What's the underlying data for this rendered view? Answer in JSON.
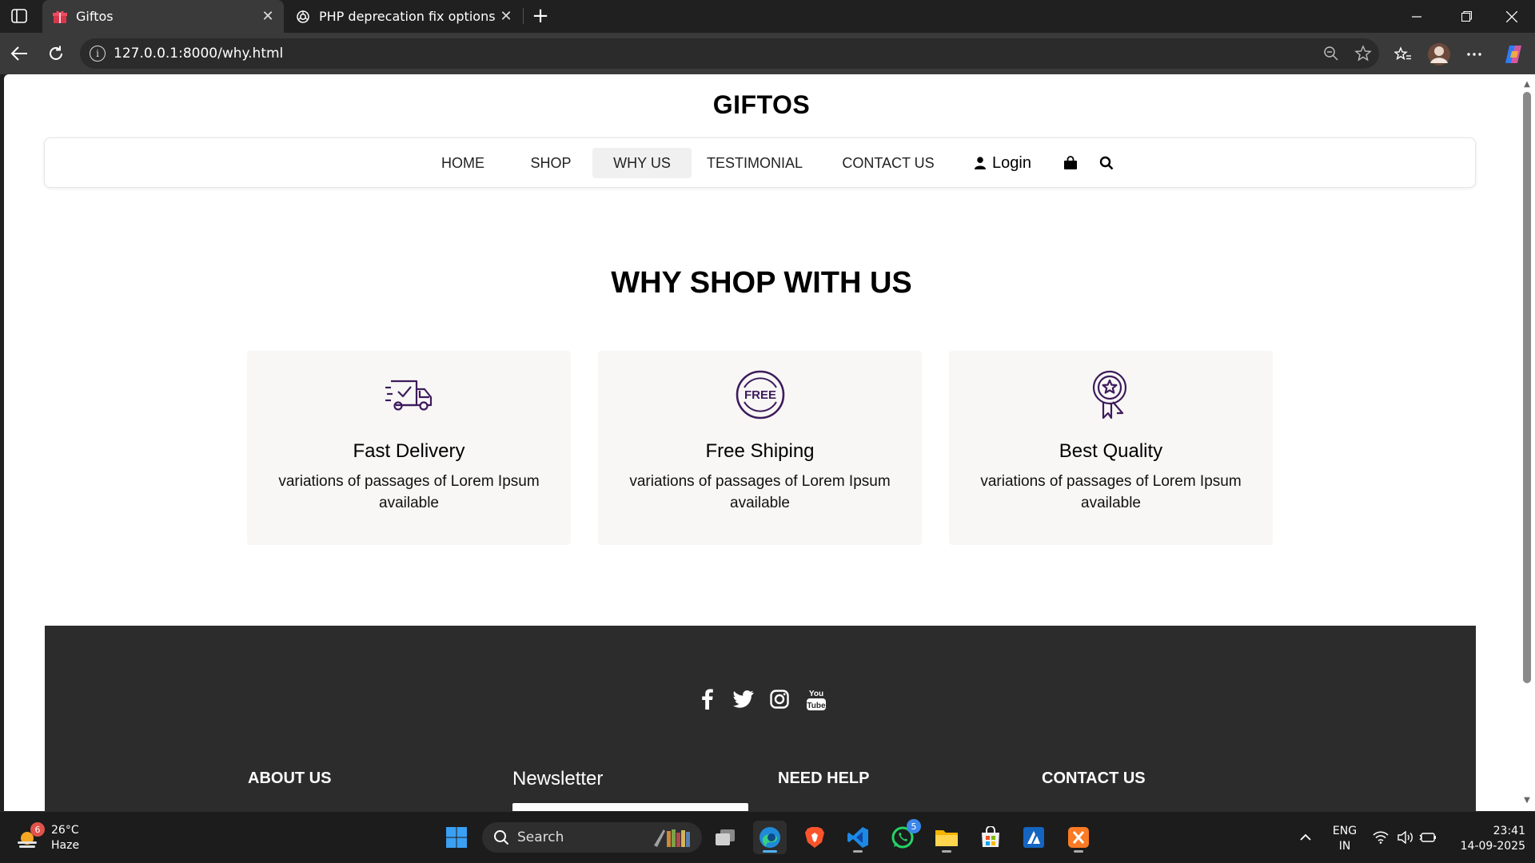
{
  "browser": {
    "tabs": [
      {
        "title": "Giftos",
        "icon": "gift-icon",
        "active": true
      },
      {
        "title": "PHP deprecation fix options",
        "icon": "openai-icon",
        "active": false
      }
    ],
    "url": "127.0.0.1:8000/why.html"
  },
  "site": {
    "brand": "GIFTOS",
    "nav": [
      {
        "label": "HOME",
        "active": false
      },
      {
        "label": "SHOP",
        "active": false
      },
      {
        "label": "WHY US",
        "active": true
      },
      {
        "label": "TESTIMONIAL",
        "active": false
      },
      {
        "label": "CONTACT US",
        "active": false
      }
    ],
    "login_label": "Login"
  },
  "why": {
    "title": "WHY SHOP WITH US",
    "cards": [
      {
        "icon": "delivery-truck-icon",
        "title": "Fast Delivery",
        "text": "variations of passages of Lorem Ipsum available"
      },
      {
        "icon": "free-badge-icon",
        "badge_text": "FREE",
        "title": "Free Shiping",
        "text": "variations of passages of Lorem Ipsum available"
      },
      {
        "icon": "quality-award-icon",
        "title": "Best Quality",
        "text": "variations of passages of Lorem Ipsum available"
      }
    ]
  },
  "footer": {
    "social": [
      "facebook-icon",
      "twitter-icon",
      "instagram-icon",
      "youtube-icon"
    ],
    "youtube_text": {
      "top": "You",
      "bottom": "Tube"
    },
    "headings": {
      "about": "ABOUT US",
      "newsletter": "Newsletter",
      "help": "NEED HELP",
      "contact": "CONTACT US"
    }
  },
  "taskbar": {
    "weather": {
      "temp": "26°C",
      "condition": "Haze",
      "badge": "6"
    },
    "search_label": "Search",
    "whatsapp_badge": "5",
    "language": {
      "line1": "ENG",
      "line2": "IN"
    },
    "clock": {
      "time": "23:41",
      "date": "14-09-2025"
    }
  },
  "colors": {
    "page_bg": "#ffffff",
    "card_bg": "#f8f7f6",
    "footer_bg": "#2d2c2d",
    "icon_purple": "#3d1b5c",
    "nav_active_bg": "#f0f0f0"
  }
}
